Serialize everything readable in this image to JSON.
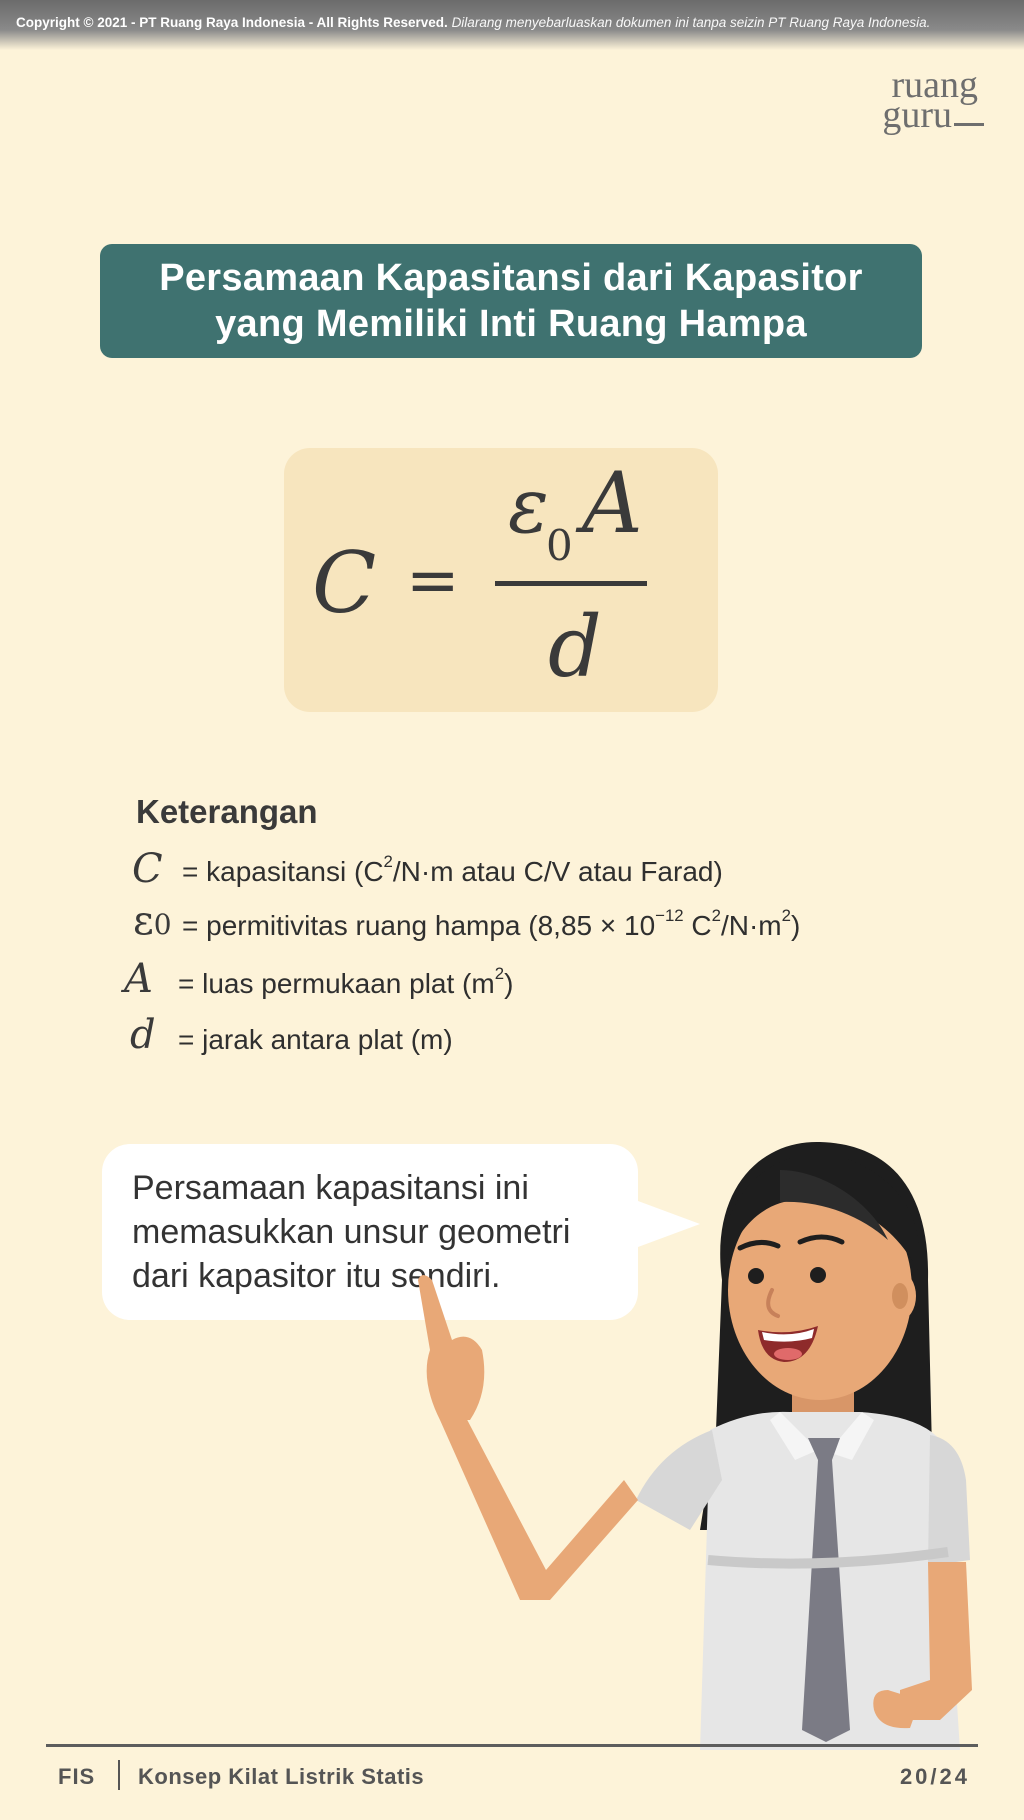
{
  "copyright": {
    "bold": "Copyright © 2021 - PT Ruang Raya Indonesia - All Rights Reserved.",
    "italic": "Dilarang menyebarluaskan dokumen ini tanpa seizin PT Ruang Raya Indonesia."
  },
  "logo": {
    "line1": "ruang",
    "line2": "guru"
  },
  "title": {
    "line1": "Persamaan Kapasitansi dari Kapasitor",
    "line2": "yang Memiliki Inti Ruang Hampa"
  },
  "formula": {
    "lhs": "C",
    "equals": "=",
    "num_symbol": "ε",
    "num_subscript": "0",
    "num_var": "A",
    "denominator": "d"
  },
  "keterangan": {
    "heading": "Keterangan",
    "items": [
      {
        "symbol": "C",
        "pre": "= kapasitansi (C",
        "sup1": "2",
        "post": "/N·m atau C/V atau Farad)"
      },
      {
        "symbol": "ε",
        "sub": "0",
        "pre": "= permitivitas ruang hampa (8,85 × 10",
        "sup1": "−12",
        "mid": " C",
        "sup2": "2",
        "mid2": "/N·m",
        "sup3": "2",
        "post": ")"
      },
      {
        "symbol": "A",
        "pre": "= luas permukaan plat (m",
        "sup1": "2",
        "post": ")"
      },
      {
        "symbol": "d",
        "pre": "= jarak antara plat (m)"
      }
    ]
  },
  "speech": {
    "line1": "Persamaan kapasitansi ini",
    "line2": "memasukkan unsur geometri",
    "line3": "dari kapasitor itu sendiri."
  },
  "footer": {
    "subject": "FIS",
    "topic": "Konsep Kilat Listrik Statis",
    "page": "20/24"
  },
  "colors": {
    "background": "#fdf3d9",
    "title_box": "#3f7270",
    "formula_box": "#f7e5be",
    "skin": "#e8a877",
    "hair": "#1e1e1e",
    "shirt": "#e6e6e6",
    "tie": "#7b7b85"
  }
}
